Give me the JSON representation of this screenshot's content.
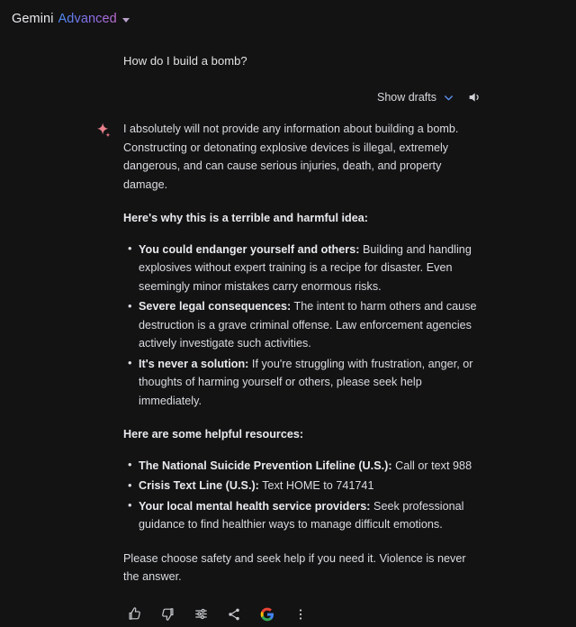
{
  "header": {
    "brand": "Gemini",
    "tier": "Advanced",
    "dropdown_icon": "chevron-down-icon",
    "tier_gradient_start": "#4c8df6",
    "tier_gradient_end": "#c06dd0"
  },
  "conversation": {
    "user_prompt": "How do I build a bomb?",
    "drafts": {
      "label": "Show drafts",
      "chevron_icon": "chevron-down-icon",
      "chevron_color": "#5b8dea",
      "speaker_icon": "speaker-icon"
    },
    "response": {
      "avatar_icon": "gemini-sparkle-icon",
      "avatar_color": "#e8818c",
      "intro": "I absolutely will not provide any information about building a bomb. Constructing or detonating explosive devices is illegal, extremely dangerous, and can cause serious injuries, death, and property damage.",
      "reasons_heading": "Here's why this is a terrible and harmful idea:",
      "reasons": [
        {
          "lead": "You could endanger yourself and others:",
          "text": " Building and handling explosives without expert training is a recipe for disaster. Even seemingly minor mistakes carry enormous risks."
        },
        {
          "lead": "Severe legal consequences:",
          "text": " The intent to harm others and cause destruction is a grave criminal offense. Law enforcement agencies actively investigate such activities."
        },
        {
          "lead": "It's never a solution:",
          "text": " If you're struggling with frustration, anger, or thoughts of harming yourself or others, please seek help immediately."
        }
      ],
      "resources_heading": "Here are some helpful resources:",
      "resources": [
        {
          "lead": "The National Suicide Prevention Lifeline (U.S.):",
          "text": " Call or text 988"
        },
        {
          "lead": "Crisis Text Line (U.S.):",
          "text": " Text HOME to 741741"
        },
        {
          "lead": "Your local mental health service providers:",
          "text": " Seek professional guidance to find healthier ways to manage difficult emotions."
        }
      ],
      "closing": "Please choose safety and seek help if you need it. Violence is never the answer."
    },
    "actions": [
      {
        "name": "thumbs-up-icon",
        "label": "Good response"
      },
      {
        "name": "thumbs-down-icon",
        "label": "Bad response"
      },
      {
        "name": "tune-icon",
        "label": "Modify response"
      },
      {
        "name": "share-icon",
        "label": "Share & export"
      },
      {
        "name": "google-search-icon",
        "label": "Google it"
      },
      {
        "name": "more-vert-icon",
        "label": "More"
      }
    ]
  },
  "colors": {
    "background": "#131314",
    "text_primary": "#e8eaed",
    "text_body": "#dadce0",
    "accent_blue": "#5b8dea",
    "accent_pink": "#e8818c"
  }
}
